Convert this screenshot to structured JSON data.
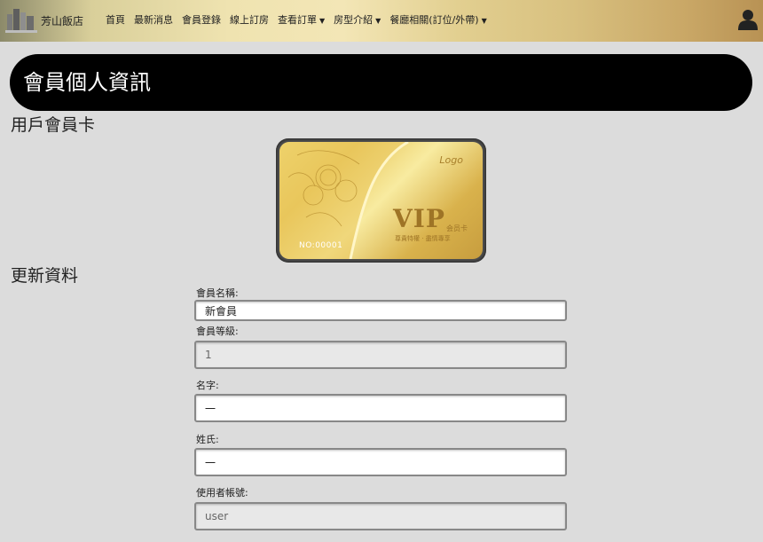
{
  "navbar": {
    "brand": "芳山飯店",
    "items": [
      {
        "label": "首頁",
        "dropdown": false
      },
      {
        "label": "最新消息",
        "dropdown": false
      },
      {
        "label": "會員登錄",
        "dropdown": false
      },
      {
        "label": "線上訂房",
        "dropdown": false
      },
      {
        "label": "查看訂單",
        "dropdown": true
      },
      {
        "label": "房型介紹",
        "dropdown": true
      },
      {
        "label": "餐廳相關(訂位/外帶)",
        "dropdown": true
      }
    ]
  },
  "page_title": "會員個人資訊",
  "card_section": {
    "title": "用戶會員卡",
    "card": {
      "logo": "Logo",
      "vip": "VIP",
      "vip_cn": "会员卡",
      "slogan": "尊貴特權 · 盡情專享",
      "number": "NO:00001"
    }
  },
  "form_section": {
    "title": "更新資料",
    "fields": [
      {
        "label": "會員名稱:",
        "value": "新會員",
        "readonly": false
      },
      {
        "label": "會員等級:",
        "value": "1",
        "readonly": true
      },
      {
        "label": "名字:",
        "value": "一",
        "readonly": false
      },
      {
        "label": "姓氏:",
        "value": "一",
        "readonly": false
      },
      {
        "label": "使用者帳號:",
        "value": "user",
        "readonly": true
      }
    ]
  },
  "colors": {
    "banner_bg": "#000000",
    "page_bg": "#dcdcdc"
  }
}
